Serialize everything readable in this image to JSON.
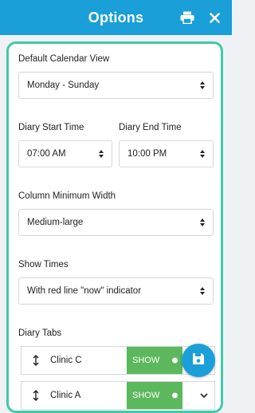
{
  "header": {
    "title": "Options",
    "print_icon": "print-icon",
    "close_icon": "close-icon",
    "color": "#1a9fd9"
  },
  "form": {
    "default_view": {
      "label": "Default Calendar View",
      "value": "Monday - Sunday"
    },
    "start_time": {
      "label": "Diary Start Time",
      "value": "07:00 AM"
    },
    "end_time": {
      "label": "Diary End Time",
      "value": "10:00 PM"
    },
    "column_width": {
      "label": "Column Minimum Width",
      "value": "Medium-large"
    },
    "show_times": {
      "label": "Show Times",
      "value": "With red line \"now\" indicator"
    }
  },
  "diary_tabs": {
    "label": "Diary Tabs",
    "items": [
      {
        "name": "Clinic C",
        "status": "SHOW"
      },
      {
        "name": "Clinic A",
        "status": "SHOW"
      }
    ]
  },
  "fab": {
    "icon": "save-icon"
  },
  "colors": {
    "accent": "#1a9fd9",
    "border": "#41c9a8",
    "show": "#5cb85c"
  }
}
